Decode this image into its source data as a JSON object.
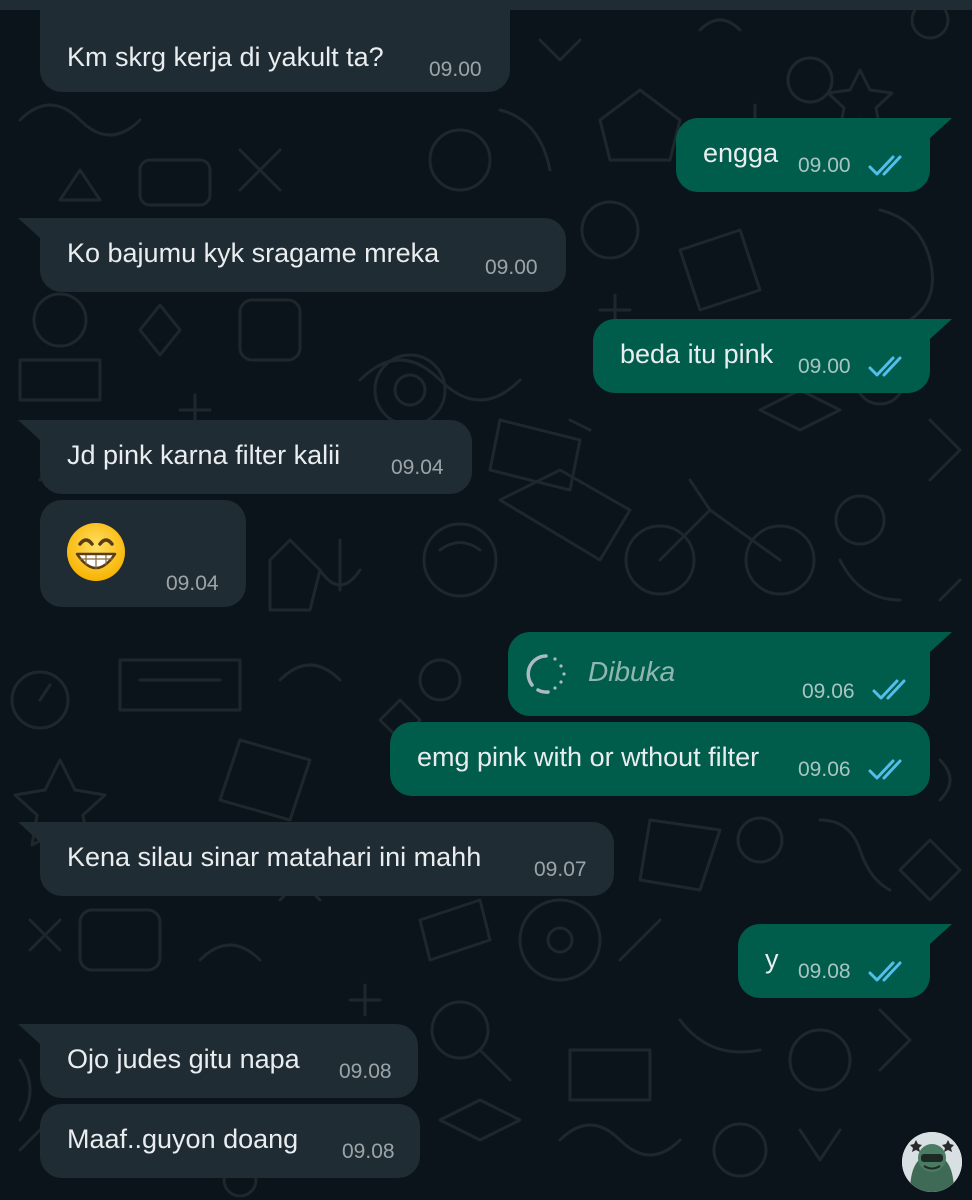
{
  "colors": {
    "background": "#0b141a",
    "incoming_bubble": "#202c33",
    "outgoing_bubble": "#005c4b",
    "read_ticks": "#53bdeb",
    "reply_accent": "#06cf9c"
  },
  "messages": [
    {
      "direction": "incoming",
      "text": "Km skrg kerja di yakult ta?",
      "time": "09.00",
      "has_reply_preview": true
    },
    {
      "direction": "outgoing",
      "text": "engga",
      "time": "09.00",
      "status": "read"
    },
    {
      "direction": "incoming",
      "text": "Ko bajumu kyk sragame mreka",
      "time": "09.00"
    },
    {
      "direction": "outgoing",
      "text": "beda itu pink",
      "time": "09.00",
      "status": "read"
    },
    {
      "direction": "incoming",
      "text": "Jd pink karna filter kalii",
      "time": "09.04"
    },
    {
      "direction": "incoming",
      "text": "",
      "emoji": "grinning-face-with-smiling-eyes",
      "time": "09.04"
    },
    {
      "direction": "outgoing",
      "text": "Dibuka",
      "type": "view-once-opened",
      "time": "09.06",
      "status": "read"
    },
    {
      "direction": "outgoing",
      "text": "emg pink with or wthout filter",
      "time": "09.06",
      "status": "read"
    },
    {
      "direction": "incoming",
      "text": "Kena silau sinar matahari ini mahh",
      "time": "09.07"
    },
    {
      "direction": "outgoing",
      "text": "y",
      "time": "09.08",
      "status": "read"
    },
    {
      "direction": "incoming",
      "text": "Ojo judes gitu napa",
      "time": "09.08"
    },
    {
      "direction": "incoming",
      "text": "Maaf..guyon doang",
      "time": "09.08"
    }
  ],
  "icons": {
    "read_status": "double-check-icon",
    "view_once": "view-once-icon",
    "emoji": "grinning-emoji-icon",
    "avatar": "sticker-avatar"
  }
}
